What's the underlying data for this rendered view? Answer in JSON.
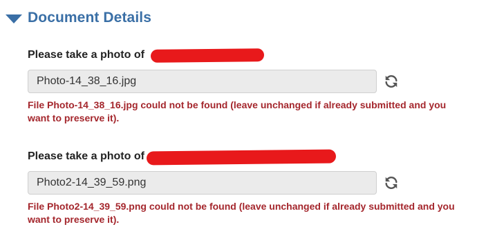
{
  "section": {
    "title": "Document Details",
    "collapsed": false,
    "caret_icon": "caret-down-icon",
    "accent_color": "#3a6fa6"
  },
  "fields": [
    {
      "label": "Please take a photo of",
      "value": "Photo-14_38_16.jpg",
      "refresh_icon": "refresh-icon",
      "error": "File Photo-14_38_16.jpg could not be found (leave unchanged if already submitted and you want to preserve it)."
    },
    {
      "label": "Please take a photo of",
      "value": "Photo2-14_39_59.png",
      "refresh_icon": "refresh-icon",
      "error": "File Photo2-14_39_59.png could not be found (leave unchanged if already submitted and you want to preserve it)."
    }
  ],
  "colors": {
    "error": "#a4262c",
    "redaction": "#e8191b",
    "input_bg": "#ebebeb"
  }
}
